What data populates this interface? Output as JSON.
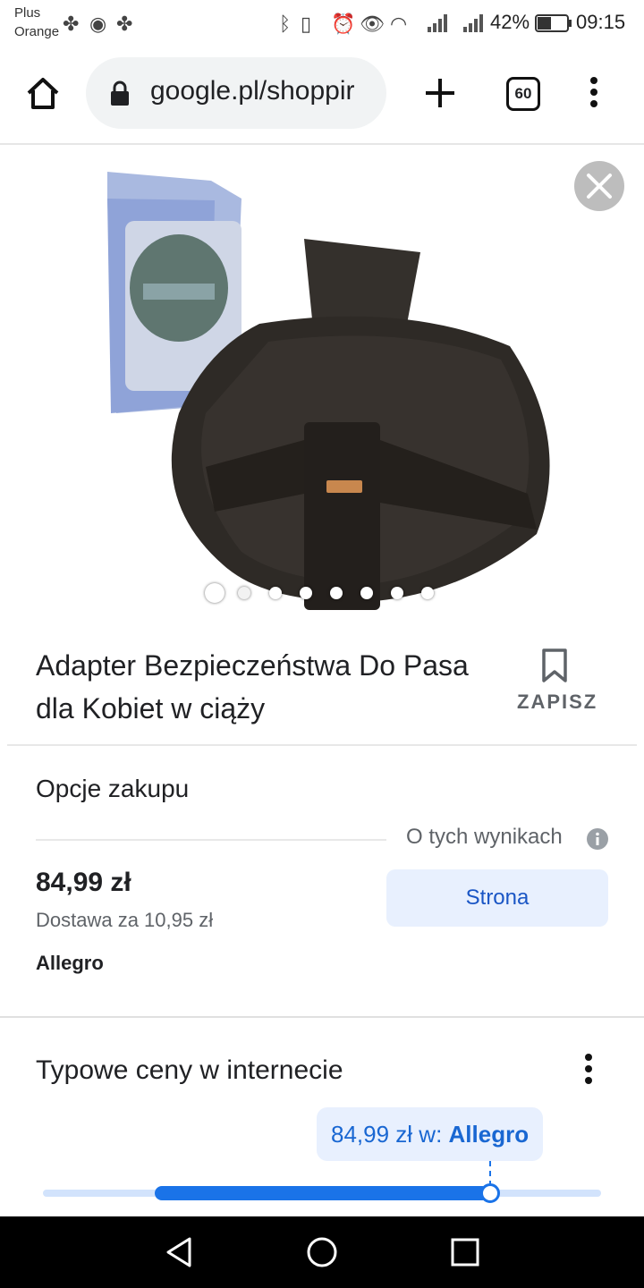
{
  "status_bar": {
    "carrier_line1": "Plus",
    "carrier_line2": "Orange",
    "battery": "42%",
    "time": "09:15"
  },
  "browser": {
    "url": "google.pl/shoppir",
    "tab_count": "60"
  },
  "gallery": {
    "image_count": 8,
    "active_index": 0
  },
  "product": {
    "title": "Adapter Bezpieczeństwa Do Pasa dla Kobiet w ciąży",
    "save_label": "ZAPISZ"
  },
  "purchase_options": {
    "heading": "Opcje zakupu",
    "about_results": "O tych wynikach",
    "price": "84,99 zł",
    "delivery": "Dostawa za 10,95 zł",
    "seller": "Allegro",
    "store_button": "Strona"
  },
  "typical_prices": {
    "heading": "Typowe ceny w internecie",
    "tooltip_price": "84,99 zł w:",
    "tooltip_store": "Allegro"
  },
  "colors": {
    "accent_blue": "#1a73e8",
    "button_bg": "#e8f0fe"
  }
}
